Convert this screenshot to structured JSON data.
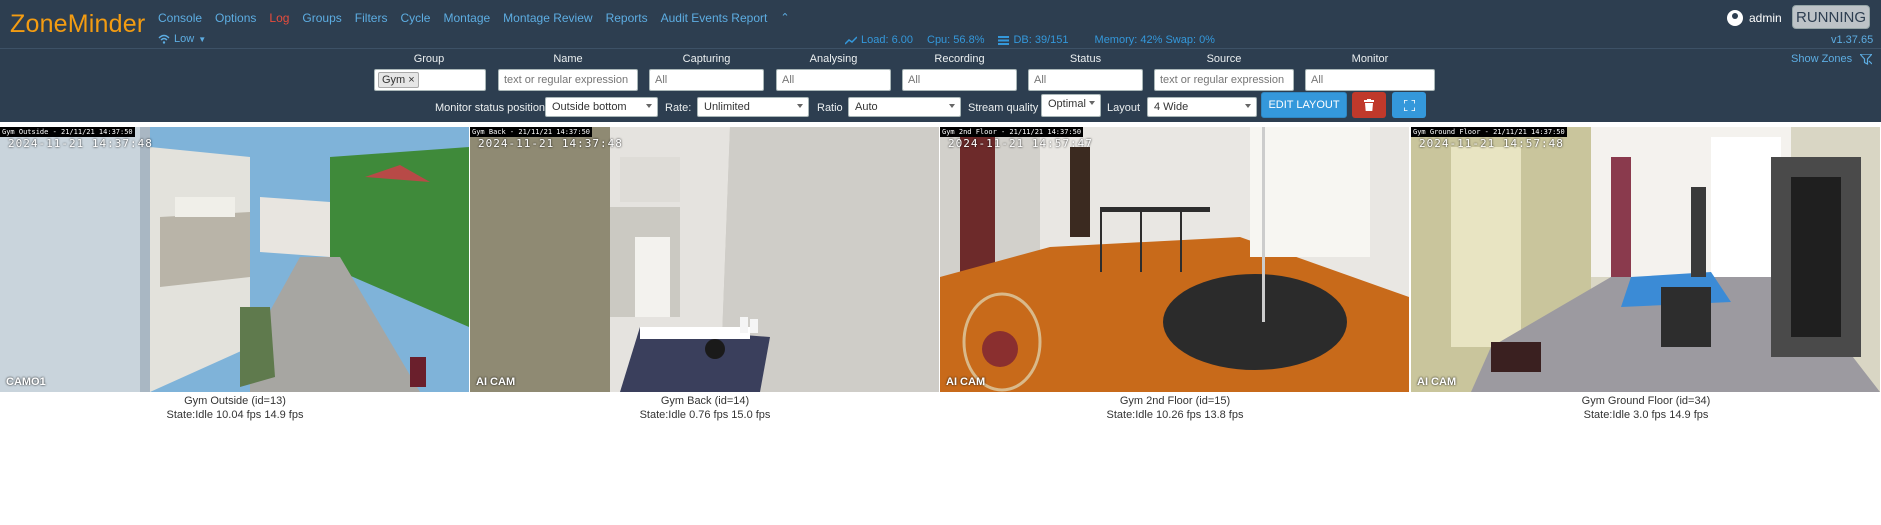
{
  "app": {
    "logo": "ZoneMinder",
    "menu": [
      "Console",
      "Options",
      "Log",
      "Groups",
      "Filters",
      "Cycle",
      "Montage",
      "Montage Review",
      "Reports",
      "Audit Events Report"
    ],
    "collapse_caret": "⌃",
    "bandwidth": "Low",
    "stats": {
      "load": "Load: 6.00",
      "cpu": "Cpu: 56.8%",
      "db": "DB: 39/151",
      "memory": "Memory: 42% Swap: 0%"
    },
    "user": "admin",
    "state_button": "RUNNING",
    "version": "v1.37.65"
  },
  "filters": {
    "group": {
      "label": "Group",
      "chip": "Gym"
    },
    "name": {
      "label": "Name",
      "placeholder": "text or regular expression"
    },
    "capturing": {
      "label": "Capturing",
      "placeholder": "All"
    },
    "analysing": {
      "label": "Analysing",
      "placeholder": "All"
    },
    "recording": {
      "label": "Recording",
      "placeholder": "All"
    },
    "status": {
      "label": "Status",
      "placeholder": "All"
    },
    "source": {
      "label": "Source",
      "placeholder": "text or regular expression"
    },
    "monitor": {
      "label": "Monitor",
      "placeholder": "All"
    },
    "show_zones": "Show Zones"
  },
  "controls": {
    "status_position_label": "Monitor status position",
    "status_position_value": "Outside bottom",
    "rate_label": "Rate:",
    "rate_value": "Unlimited",
    "ratio_label": "Ratio",
    "ratio_value": "Auto",
    "quality_label": "Stream quality",
    "quality_value": "Optimal",
    "layout_label": "Layout",
    "layout_value": "4 Wide",
    "edit_layout": "EDIT LAYOUT"
  },
  "monitors": [
    {
      "title_osd": "Gym Outside - 21/11/21 14:37:50",
      "timestamp": "2024-11-21 14:37:48",
      "cam_label": "CAMO1",
      "name": "Gym Outside (id=13)",
      "state": "State:Idle 10.04 fps 14.9 fps"
    },
    {
      "title_osd": "Gym Back - 21/11/21 14:37:50",
      "timestamp": "2024-11-21 14:37:48",
      "cam_label": "AI CAM",
      "name": "Gym Back (id=14)",
      "state": "State:Idle 0.76 fps 15.0 fps"
    },
    {
      "title_osd": "Gym 2nd Floor - 21/11/21 14:37:50",
      "timestamp": "2024-11-21 14:57:47",
      "cam_label": "AI CAM",
      "name": "Gym 2nd Floor (id=15)",
      "state": "State:Idle 10.26 fps 13.8 fps"
    },
    {
      "title_osd": "Gym Ground Floor - 21/11/21 14:37:50",
      "timestamp": "2024-11-21 14:57:48",
      "cam_label": "AI CAM",
      "name": "Gym Ground Floor (id=34)",
      "state": "State:Idle 3.0 fps 14.9 fps"
    }
  ]
}
